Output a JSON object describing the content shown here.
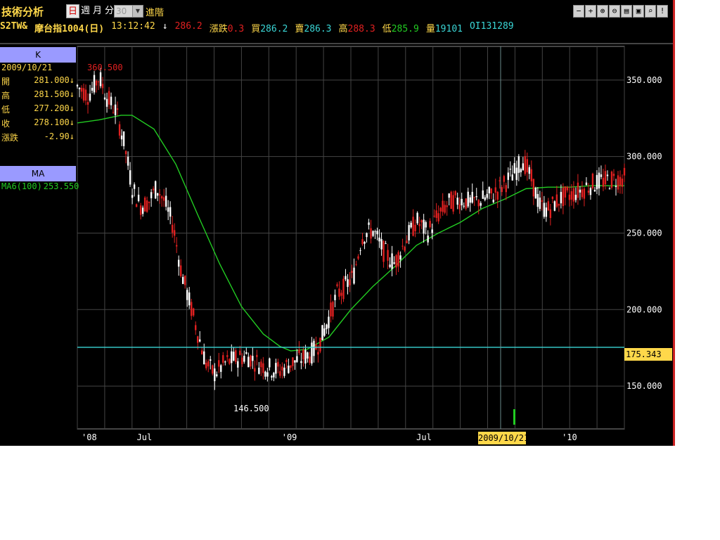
{
  "app": {
    "title": "技術分析",
    "periods": [
      "日",
      "週",
      "月",
      "分"
    ],
    "active_period": "日",
    "minute_value": "30",
    "advanced_label": "進階",
    "toolbar_icons": [
      "minus-icon",
      "plus-icon",
      "zoom-in-icon",
      "zoom-out-icon",
      "print-icon",
      "save-icon",
      "search-icon",
      "info-icon"
    ],
    "toolbar_glyphs": [
      "−",
      "+",
      "⊕",
      "⊖",
      "▤",
      "▣",
      "⌕",
      "!"
    ]
  },
  "quote": {
    "symbol": "S2TW&",
    "name": "摩台指1004(日)",
    "time": "13:12:42",
    "arrow": "↓",
    "last": "286.2",
    "change_label": "漲跌",
    "change": "0.3",
    "bid_label": "買",
    "bid": "286.2",
    "ask_label": "賣",
    "ask": "286.3",
    "high_label": "高",
    "high": "288.3",
    "low_label": "低",
    "low": "285.9",
    "vol_label": "量",
    "vol": "19101",
    "oi_label": "OI",
    "oi": "131289"
  },
  "k_panel": {
    "header": "K",
    "date": "2009/10/21",
    "rows": [
      {
        "label": "開",
        "value": "281.000↓"
      },
      {
        "label": "高",
        "value": "281.500↓"
      },
      {
        "label": "低",
        "value": "277.200↓"
      },
      {
        "label": "收",
        "value": "278.100↓"
      },
      {
        "label": "漲跌",
        "value": "-2.90↓"
      }
    ]
  },
  "ma_panel": {
    "header": "MA",
    "label": "MA6(100)",
    "value": "253.550"
  },
  "colors": {
    "up": "#e02020",
    "down": "#ffffff",
    "ma": "#22cc22",
    "grid": "#444444",
    "hline": "#3ad6d6",
    "cursor": "#6a8a8a"
  },
  "chart_data": {
    "type": "candlestick",
    "y_axis_labels": [
      "350.000",
      "300.000",
      "250.000",
      "200.000",
      "150.000"
    ],
    "y_axis_values": [
      350,
      300,
      250,
      200,
      150
    ],
    "ylim": [
      122,
      372
    ],
    "x_axis_labels": [
      "'08",
      "Jul",
      "'09",
      "Jul",
      "'10"
    ],
    "x_axis_positions": [
      0.0,
      0.101,
      0.366,
      0.612,
      0.878
    ],
    "max_label": "360.500",
    "min_label": "146.500",
    "horizontal_line": 175.343,
    "horizontal_line_label": "175.343",
    "cursor_date": "2009/10/21",
    "close_path": [
      [
        0.0,
        346
      ],
      [
        0.02,
        340
      ],
      [
        0.04,
        352
      ],
      [
        0.055,
        338
      ],
      [
        0.07,
        330
      ],
      [
        0.085,
        310
      ],
      [
        0.1,
        280
      ],
      [
        0.115,
        268
      ],
      [
        0.13,
        270
      ],
      [
        0.145,
        280
      ],
      [
        0.16,
        270
      ],
      [
        0.175,
        255
      ],
      [
        0.19,
        225
      ],
      [
        0.205,
        205
      ],
      [
        0.22,
        185
      ],
      [
        0.235,
        165
      ],
      [
        0.25,
        158
      ],
      [
        0.27,
        165
      ],
      [
        0.29,
        168
      ],
      [
        0.31,
        170
      ],
      [
        0.33,
        165
      ],
      [
        0.35,
        162
      ],
      [
        0.37,
        160
      ],
      [
        0.39,
        165
      ],
      [
        0.41,
        168
      ],
      [
        0.43,
        172
      ],
      [
        0.445,
        180
      ],
      [
        0.46,
        195
      ],
      [
        0.475,
        210
      ],
      [
        0.49,
        215
      ],
      [
        0.505,
        222
      ],
      [
        0.52,
        248
      ],
      [
        0.54,
        252
      ],
      [
        0.56,
        238
      ],
      [
        0.58,
        230
      ],
      [
        0.6,
        245
      ],
      [
        0.62,
        258
      ],
      [
        0.64,
        250
      ],
      [
        0.66,
        262
      ],
      [
        0.68,
        270
      ],
      [
        0.7,
        272
      ],
      [
        0.72,
        270
      ],
      [
        0.74,
        272
      ],
      [
        0.76,
        275
      ],
      [
        0.78,
        282
      ],
      [
        0.8,
        290
      ],
      [
        0.815,
        298
      ],
      [
        0.83,
        285
      ],
      [
        0.845,
        268
      ],
      [
        0.86,
        265
      ],
      [
        0.88,
        272
      ],
      [
        0.9,
        275
      ],
      [
        0.92,
        278
      ],
      [
        0.94,
        282
      ],
      [
        0.96,
        284
      ],
      [
        1.0,
        286
      ]
    ],
    "ma_series_name": "MA6(100)",
    "ma_path": [
      [
        0.0,
        322
      ],
      [
        0.04,
        324
      ],
      [
        0.08,
        327
      ],
      [
        0.1,
        327
      ],
      [
        0.14,
        318
      ],
      [
        0.18,
        295
      ],
      [
        0.22,
        262
      ],
      [
        0.26,
        230
      ],
      [
        0.3,
        202
      ],
      [
        0.34,
        184
      ],
      [
        0.37,
        176
      ],
      [
        0.39,
        173
      ],
      [
        0.42,
        174
      ],
      [
        0.46,
        182
      ],
      [
        0.5,
        200
      ],
      [
        0.54,
        215
      ],
      [
        0.58,
        228
      ],
      [
        0.62,
        242
      ],
      [
        0.66,
        250
      ],
      [
        0.7,
        257
      ],
      [
        0.74,
        266
      ],
      [
        0.78,
        272
      ],
      [
        0.82,
        279
      ],
      [
        0.86,
        280
      ],
      [
        0.9,
        280
      ],
      [
        0.94,
        281
      ],
      [
        1.0,
        281
      ]
    ]
  }
}
